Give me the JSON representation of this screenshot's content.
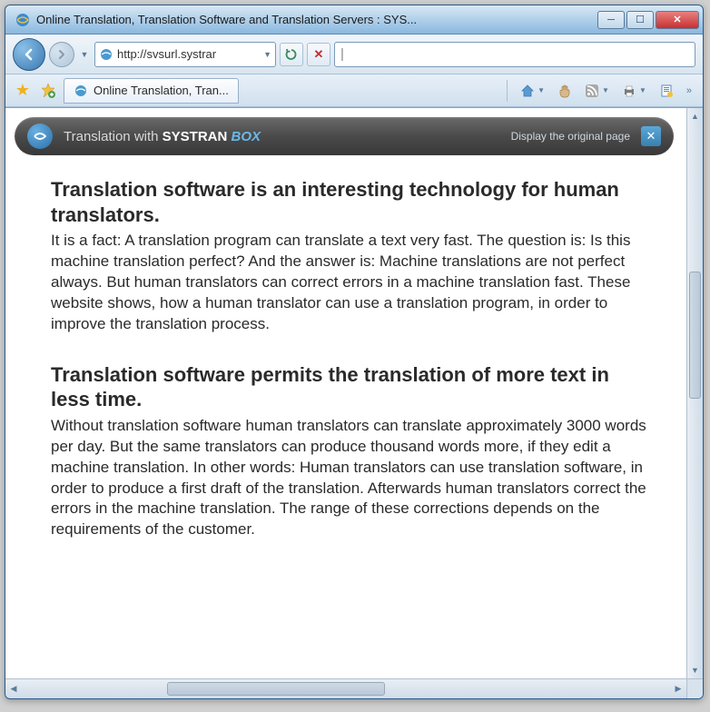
{
  "window": {
    "title": "Online Translation, Translation Software and Translation Servers : SYS..."
  },
  "nav": {
    "url": "http://svsurl.systrar",
    "search_placeholder": ""
  },
  "tab": {
    "label": "Online Translation, Tran..."
  },
  "systran": {
    "prefix": "Translation with ",
    "brand": "SYSTRAN",
    "box": "BOX",
    "link": "Display the original page"
  },
  "article": {
    "h1": "Translation software is an interesting technology for human translators.",
    "p1": "It is a fact: A translation program can translate a text very fast. The question is: Is this machine translation perfect? And the answer is: Machine translations are not perfect always. But human translators can correct errors in a machine translation fast. These website shows, how a human translator can use a translation program, in order to improve the translation process.",
    "h2": "Translation software permits the translation of more text in less time.",
    "p2": "Without translation software human translators can translate approximately 3000 words per day. But the same translators can produce thousand words more, if they edit a machine translation. In other words: Human translators can use translation software, in order to produce a first draft of the translation. Afterwards human translators correct the errors in the machine translation. The range of these corrections depends on the requirements of the customer."
  }
}
